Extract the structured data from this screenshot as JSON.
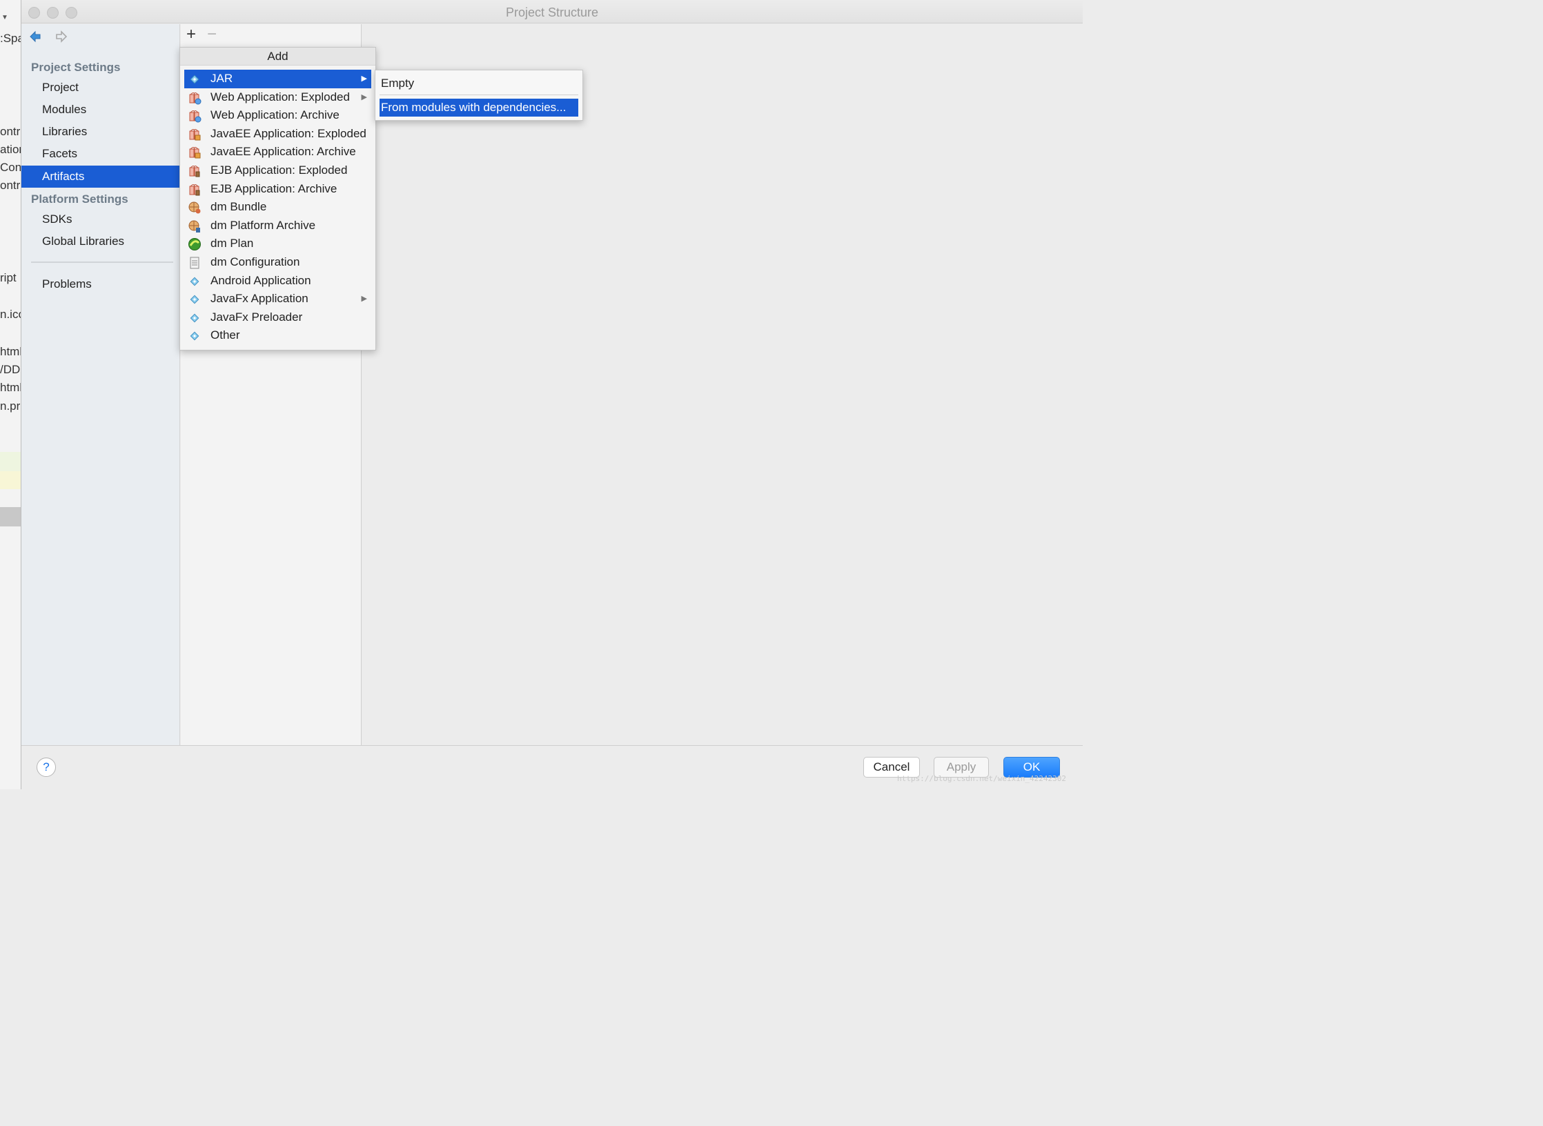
{
  "background_ide": {
    "fragments": [
      ":Spa",
      "ontr",
      "ation",
      "Cont",
      "ontr",
      "ript",
      "n.ico",
      "html",
      "/DD.",
      "html",
      "n.pr"
    ]
  },
  "dialog": {
    "title": "Project Structure"
  },
  "sidebar": {
    "project_settings_header": "Project Settings",
    "project_items": [
      "Project",
      "Modules",
      "Libraries",
      "Facets",
      "Artifacts"
    ],
    "selected_item": "Artifacts",
    "platform_settings_header": "Platform Settings",
    "platform_items": [
      "SDKs",
      "Global Libraries"
    ],
    "problems": "Problems"
  },
  "toolbar": {
    "add_symbol": "+",
    "remove_symbol": "−"
  },
  "add_menu": {
    "title": "Add",
    "items": [
      {
        "label": "JAR",
        "icon": "jar-icon",
        "submenu": true,
        "selected": true
      },
      {
        "label": "Web Application: Exploded",
        "icon": "web-app-exploded-icon",
        "submenu": true
      },
      {
        "label": "Web Application: Archive",
        "icon": "web-app-archive-icon"
      },
      {
        "label": "JavaEE Application: Exploded",
        "icon": "javaee-exploded-icon"
      },
      {
        "label": "JavaEE Application: Archive",
        "icon": "javaee-archive-icon"
      },
      {
        "label": "EJB Application: Exploded",
        "icon": "ejb-exploded-icon"
      },
      {
        "label": "EJB Application: Archive",
        "icon": "ejb-archive-icon"
      },
      {
        "label": "dm Bundle",
        "icon": "dm-bundle-icon"
      },
      {
        "label": "dm Platform Archive",
        "icon": "dm-platform-archive-icon"
      },
      {
        "label": "dm Plan",
        "icon": "dm-plan-icon"
      },
      {
        "label": "dm Configuration",
        "icon": "dm-configuration-icon"
      },
      {
        "label": "Android Application",
        "icon": "android-app-icon"
      },
      {
        "label": "JavaFx Application",
        "icon": "javafx-app-icon",
        "submenu": true
      },
      {
        "label": "JavaFx Preloader",
        "icon": "javafx-preloader-icon"
      },
      {
        "label": "Other",
        "icon": "other-icon"
      }
    ]
  },
  "jar_submenu": {
    "items": [
      "Empty",
      "From modules with dependencies..."
    ],
    "selected": "From modules with dependencies..."
  },
  "buttons": {
    "help": "?",
    "cancel": "Cancel",
    "apply": "Apply",
    "ok": "OK"
  },
  "watermark": "https://blog.csdn.net/weixin_42242302",
  "colors": {
    "selection": "#1a5dd4",
    "ok_button": "#1b7dfb",
    "section_header": "#6d7b88",
    "sidebar_bg": "#e9edf1"
  }
}
